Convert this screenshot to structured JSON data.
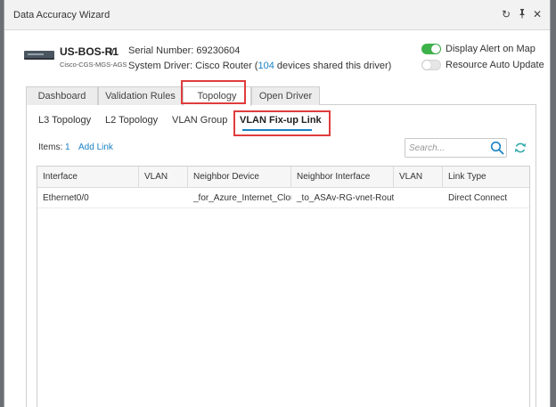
{
  "window": {
    "title": "Data Accuracy Wizard",
    "controls": [
      {
        "name": "refresh-window-icon",
        "glyph": "↻"
      },
      {
        "name": "pin-icon",
        "glyph": "✦"
      },
      {
        "name": "close-icon",
        "glyph": "✕"
      }
    ]
  },
  "device": {
    "name": "US-BOS-R1",
    "chevron": "∨",
    "model": "Cisco-CGS-MGS-AGS",
    "serial_label": "Serial Number: 69230604",
    "driver_prefix": "System Driver: Cisco Router (",
    "driver_count": "104",
    "driver_suffix": " devices shared this driver)"
  },
  "toggles": {
    "display_alert": {
      "label": "Display Alert on Map",
      "on": true
    },
    "auto_update": {
      "label": "Resource Auto Update",
      "on": false
    }
  },
  "tabs": [
    {
      "label": "Dashboard",
      "active": false
    },
    {
      "label": "Validation Rules",
      "active": false
    },
    {
      "label": "Topology",
      "active": true
    },
    {
      "label": "Open Driver",
      "active": false
    }
  ],
  "subtabs": [
    {
      "label": "L3 Topology",
      "active": false
    },
    {
      "label": "L2 Topology",
      "active": false
    },
    {
      "label": "VLAN Group",
      "active": false
    },
    {
      "label": "VLAN Fix-up Link",
      "active": true
    }
  ],
  "toolbar": {
    "items_label": "Items: ",
    "items_count": "1",
    "add_link": "Add Link",
    "search_placeholder": "Search..."
  },
  "table": {
    "columns": [
      "Interface",
      "VLAN",
      "Neighbor Device",
      "Neighbor Interface",
      "VLAN",
      "Link Type"
    ],
    "rows": [
      [
        "Ethernet0/0",
        "",
        "_for_Azure_Internet_Cloud",
        "_to_ASAv-RG-vnet-Router(",
        "",
        "Direct Connect"
      ]
    ]
  },
  "colors": {
    "accent": "#1a82c4",
    "toggle_on": "#3eb24a",
    "highlight": "#e03c3c"
  }
}
